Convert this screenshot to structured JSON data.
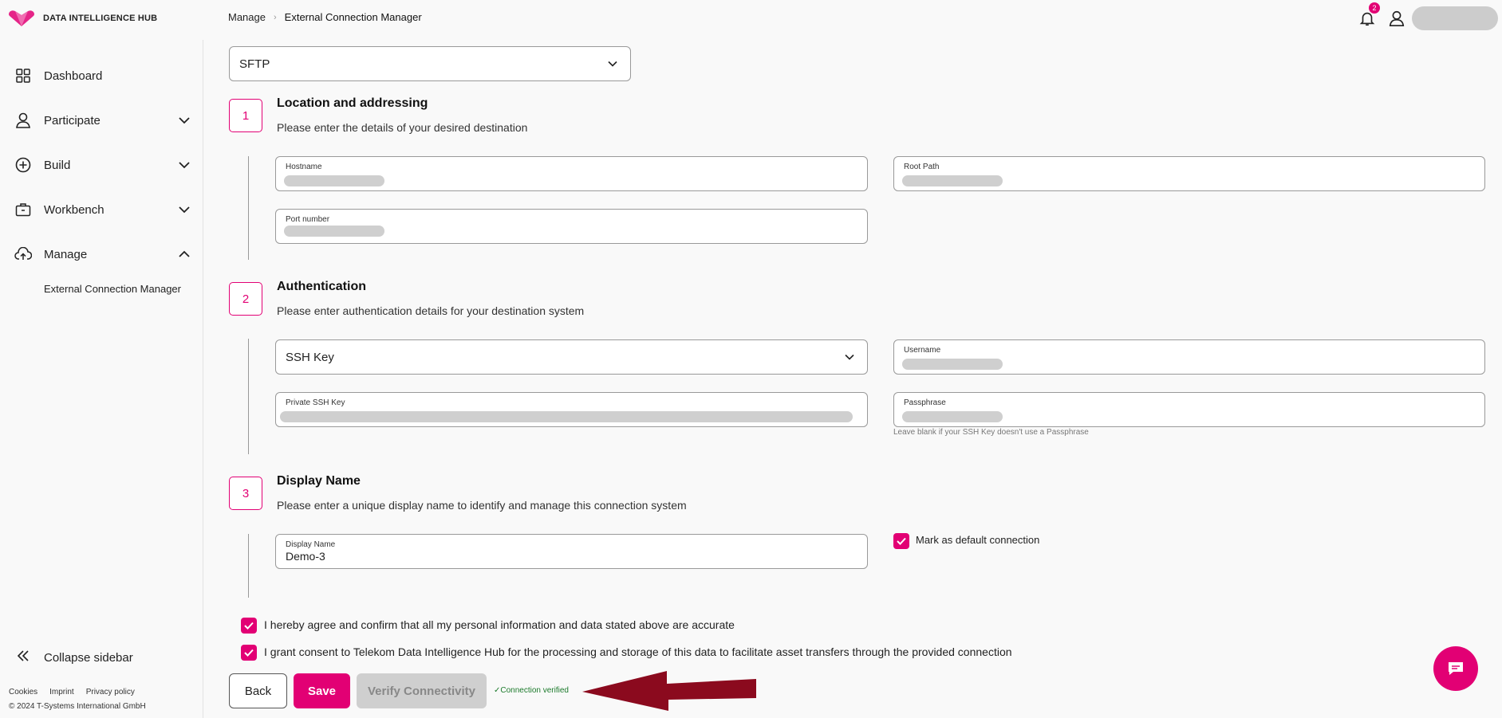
{
  "header": {
    "logo_text": "DATA INTELLIGENCE HUB",
    "breadcrumb": [
      "Manage",
      "External Connection Manager"
    ],
    "breadcrumb_sep": "›",
    "notification_count": "2",
    "accent_color": "#e20074"
  },
  "sidebar": {
    "items": [
      {
        "label": "Dashboard",
        "icon": "grid-icon"
      },
      {
        "label": "Participate",
        "icon": "person-icon"
      },
      {
        "label": "Build",
        "icon": "plus-circle-icon"
      },
      {
        "label": "Workbench",
        "icon": "briefcase-icon"
      },
      {
        "label": "Manage",
        "icon": "cloud-upload-icon"
      }
    ],
    "sub_item": "External Connection Manager",
    "collapse_label": "Collapse sidebar",
    "footer_links": [
      "Cookies",
      "Imprint",
      "Privacy policy"
    ],
    "copyright": "© 2024 T-Systems International GmbH"
  },
  "form": {
    "protocol": "SFTP",
    "steps": [
      {
        "number": "1",
        "title": "Location and addressing",
        "desc": "Please enter the details of your desired destination"
      },
      {
        "number": "2",
        "title": "Authentication",
        "desc": "Please enter authentication details for your destination system"
      },
      {
        "number": "3",
        "title": "Display Name",
        "desc": "Please enter a unique display name to identify and manage this connection system"
      }
    ],
    "hostname_label": "Hostname",
    "root_path_label": "Root Path",
    "port_label": "Port number",
    "auth_method": "SSH Key",
    "username_label": "Username",
    "private_key_label": "Private SSH Key",
    "passphrase_label": "Passphrase",
    "passphrase_hint": "Leave blank if your SSH Key doesn't use a Passphrase",
    "display_name_label": "Display Name",
    "display_name_value": "Demo-3",
    "default_connection_label": "Mark as default connection",
    "default_connection_checked": true,
    "consent_1": "I hereby agree and confirm that all my personal information and data stated above are accurate",
    "consent_2": "I grant consent to Telekom Data Intelligence Hub for the processing and storage of this data to facilitate asset transfers through the provided connection"
  },
  "actions": {
    "back": "Back",
    "save": "Save",
    "verify": "Verify Connectivity",
    "status": "✓Connection verified"
  }
}
